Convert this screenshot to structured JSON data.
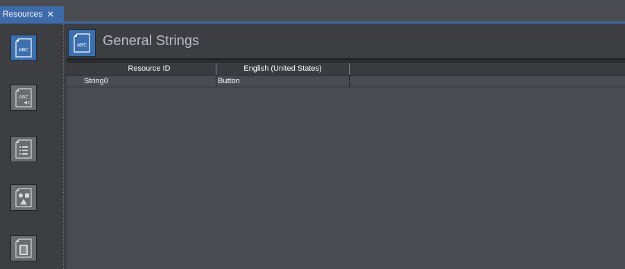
{
  "tab": {
    "label": "Resources",
    "close_glyph": "✕"
  },
  "rail": {
    "items": [
      {
        "name": "general-strings",
        "icon": "abc-document-icon",
        "active": true
      },
      {
        "name": "speech-strings",
        "icon": "abc-speaker-document-icon",
        "active": false
      },
      {
        "name": "list",
        "icon": "list-document-icon",
        "active": false
      },
      {
        "name": "images",
        "icon": "shapes-document-icon",
        "active": false
      },
      {
        "name": "files",
        "icon": "block-document-icon",
        "active": false
      }
    ]
  },
  "header": {
    "title": "General Strings",
    "icon": "abc-document-icon"
  },
  "table": {
    "columns": [
      "Resource ID",
      "English (United States)"
    ],
    "rows": [
      {
        "resource_id": "String0",
        "english": "Button"
      }
    ]
  },
  "colors": {
    "accent": "#3d6aa8",
    "background": "#3d3e42",
    "grid": "#4a4b50"
  }
}
